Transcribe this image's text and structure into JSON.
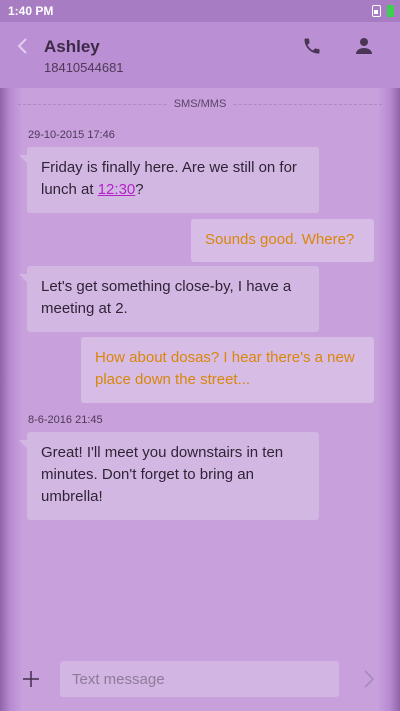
{
  "status_bar": {
    "time": "1:40 PM",
    "battery_color": "#39d14f"
  },
  "header": {
    "contact_name": "Ashley",
    "phone_number": "18410544681"
  },
  "thread": {
    "channel_label": "SMS/MMS",
    "messages": [
      {
        "timestamp": "29-10-2015 17:46",
        "direction": "incoming",
        "text_before_link": "Friday is finally here. Are we still on for lunch at ",
        "link_text": "12:30",
        "text_after_link": "?"
      },
      {
        "direction": "outgoing",
        "text": "Sounds good. Where?"
      },
      {
        "direction": "incoming",
        "text": "Let's get something close-by, I have a meeting at 2."
      },
      {
        "direction": "outgoing",
        "text": "How about dosas? I hear there's a new place down the street..."
      },
      {
        "timestamp": "8-6-2016 21:45",
        "direction": "incoming",
        "text": "Great! I'll meet you downstairs in ten minutes. Don't forget to bring an umbrella!"
      }
    ]
  },
  "composer": {
    "placeholder": "Text message",
    "value": ""
  },
  "colors": {
    "incoming_text": "#2f2436",
    "outgoing_text": "#d9860b",
    "link": "#b322c9"
  }
}
